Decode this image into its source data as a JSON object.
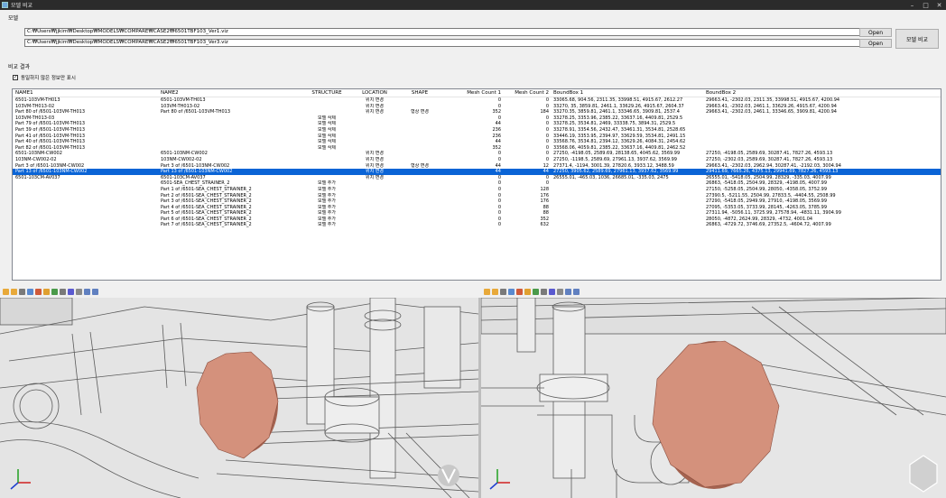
{
  "window": {
    "title": "모델 비교"
  },
  "model_group": {
    "label": "모델",
    "path1": "C:₩Users₩jjkim₩Desktop₩MODELS₩COMPARE₩CASE2₩6501TBF103_Ver1.viz",
    "path2": "C:₩Users₩jjkim₩Desktop₩MODELS₩COMPARE₩CASE2₩6501TBF103_Ver3.viz",
    "open_label": "Open",
    "compare_label": "모델 비교"
  },
  "result": {
    "label": "비교 결과",
    "checkbox_label": "동일하지 않은 정보만 표시",
    "checked": "✓"
  },
  "table": {
    "columns": [
      "NAME1",
      "NAME2",
      "STRUCTURE",
      "LOCATION",
      "SHAPE",
      "Mesh Count 1",
      "Mesh Count 2",
      "BoundBox 1",
      "BoundBox 2"
    ],
    "rows": [
      [
        "6501-103VM-TH013",
        "6501-103VM-TH013",
        "",
        "위치 변경",
        "",
        "0",
        "0",
        "33065.68, 904.56, 2311.35, 33998.51, 4915.67, 2612.27",
        "29663.41, -2302.03, 2311.35, 33998.51, 4915.67, 4200.94"
      ],
      [
        "103VM-TH013-02",
        "103VM-TH013-02",
        "",
        "위치 변경",
        "",
        "0",
        "0",
        "33270, 35, 3859.81, 2461.1, 33629.26, 4915.67, 2604.37",
        "29663.41, -2302.03, 2461.1, 33629.26, 4915.67, 4200.94"
      ],
      [
        "Part 80 of /6501-103VM-TH013",
        "Part 80 of /6501-103VM-TH013",
        "",
        "위치 변경",
        "형상 변경",
        "352",
        "184",
        "33270.35, 3859.81, 2461.1, 33346.65, 3909.81, 2537.4",
        "29663.41, -2302.03, 2461.1, 33346.65, 3909.81, 4200.94"
      ],
      [
        "103VM-TH013-03",
        "",
        "모델 삭제",
        "",
        "",
        "0",
        "0",
        "33278.25, 3353.96, 2385.22, 33637.16, 4409.81, 2529.5",
        ""
      ],
      [
        "Part 79 of /6501-103VM-TH013",
        "",
        "모델 삭제",
        "",
        "",
        "44",
        "0",
        "33278.25, 3534.81, 2469, 33338.75, 3894.31, 2529.5",
        ""
      ],
      [
        "Part 39 of /6501-103VM-TH013",
        "",
        "모델 삭제",
        "",
        "",
        "236",
        "0",
        "33278.91, 3354.56, 2432.47, 33461.31, 3534.81, 2528.65",
        ""
      ],
      [
        "Part 41 of /6501-103VM-TH013",
        "",
        "모델 삭제",
        "",
        "",
        "236",
        "0",
        "33446.19, 3353.95, 2394.97, 33629.59, 3534.81, 2491.15",
        ""
      ],
      [
        "Part 40 of /6501-103VM-TH013",
        "",
        "모델 삭제",
        "",
        "",
        "44",
        "0",
        "33568.76, 3534.81, 2394.12, 33629.26, 4084.31, 2454.62",
        ""
      ],
      [
        "Part 82 of /6501-103VM-TH013",
        "",
        "모델 삭제",
        "",
        "",
        "352",
        "0",
        "33568.06, 4059.81, 2385.22, 33637.16, 4409.81, 2462.52",
        ""
      ],
      [
        "6501-103NM-CW002",
        "6501-103NM-CW002",
        "",
        "위치 변경",
        "",
        "0",
        "0",
        "27250, -4198.05, 2589.69, 28138.65, 4045.62, 3569.99",
        "27250, -4198.05, 2589.69, 30287.41, 7827.26, 4593.13"
      ],
      [
        "103NM-CW002-02",
        "103NM-CW002-02",
        "",
        "위치 변경",
        "",
        "0",
        "0",
        "27250, -1198.5, 2589.69, 27961.13, 3937.62, 3569.99",
        "27250, -2302.03, 2589.69, 30287.41, 7827.26, 4593.13"
      ],
      [
        "Part 3 of /6501-103NM-CW002",
        "Part 3 of /6501-103NM-CW002",
        "",
        "위치 변경",
        "형상 변경",
        "44",
        "12",
        "27371.4, -1194, 3001.39, 27820.6, 3933.12, 3488.59",
        "29663.41, -2302.03, 2962.94, 30287.41, -2192.03, 3004.94"
      ],
      [
        "Part 13 of /6501-103NM-CW002",
        "Part 13 of /6501-103NM-CW002",
        "",
        "위치 변경",
        "",
        "44",
        "44",
        "27250, 3905.62, 2589.69, 27961.13, 3937.62, 3569.99",
        "29411.69, 7665.26, 4375.13, 29941.69, 7827.26, 4593.13"
      ],
      [
        "6501-103CM-AV037",
        "6501-103CM-AV037",
        "",
        "위치 변경",
        "",
        "0",
        "0",
        "26555.01, -465.03, 1036, 26685.01, -335.03, 2475",
        "26555.01, -5418.05, 2504.99, 28329, -335.03, 4007.99"
      ],
      [
        "",
        "6501-SEA_CHEST_STRAINER_2",
        "모델 추가",
        "",
        "",
        "0",
        "0",
        "",
        "26863, -5418.05, 2504.99, 28329, -4198.05, 4007.99"
      ],
      [
        "",
        "Part 1 of /6501-SEA_CHEST_STRAINER_2",
        "모델 추가",
        "",
        "",
        "0",
        "128",
        "",
        "27150, -5258.05, 2504.99, 28050, -4358.05, 3752.99"
      ],
      [
        "",
        "Part 2 of /6501-SEA_CHEST_STRAINER_2",
        "모델 추가",
        "",
        "",
        "0",
        "176",
        "",
        "27390.5, -5211.55, 2504.99, 27833.5, -4404.55, 2508.99"
      ],
      [
        "",
        "Part 3 of /6501-SEA_CHEST_STRAINER_2",
        "모델 추가",
        "",
        "",
        "0",
        "176",
        "",
        "27290, -5418.05, 2949.99, 27910, -4198.05, 3569.99"
      ],
      [
        "",
        "Part 4 of /6501-SEA_CHEST_STRAINER_2",
        "모델 추가",
        "",
        "",
        "0",
        "88",
        "",
        "27095, -5353.05, 3733.99, 28145, -4263.05, 3785.99"
      ],
      [
        "",
        "Part 5 of /6501-SEA_CHEST_STRAINER_2",
        "모델 추가",
        "",
        "",
        "0",
        "88",
        "",
        "27311.94, -5056.11, 3725.99, 27578.94, -4831.11, 3904.99"
      ],
      [
        "",
        "Part 6 of /6501-SEA_CHEST_STRAINER_2",
        "모델 추가",
        "",
        "",
        "0",
        "352",
        "",
        "28050, -4872, 2624.99, 28329, -4732, 4001.04"
      ],
      [
        "",
        "Part 7 of /6501-SEA_CHEST_STRAINER_2",
        "모델 추가",
        "",
        "",
        "0",
        "632",
        "",
        "26863, -4729.72, 3746.69, 27352.5, -4604.72, 4007.99"
      ]
    ],
    "selected_index": 12
  },
  "icons": [
    "folder-open",
    "folder-save",
    "shape",
    "select",
    "zoom",
    "color",
    "visibility",
    "measure",
    "section",
    "tree",
    "settings",
    "help"
  ],
  "colors": {
    "selection": "#0a64d6",
    "flange": "#d4917c"
  }
}
